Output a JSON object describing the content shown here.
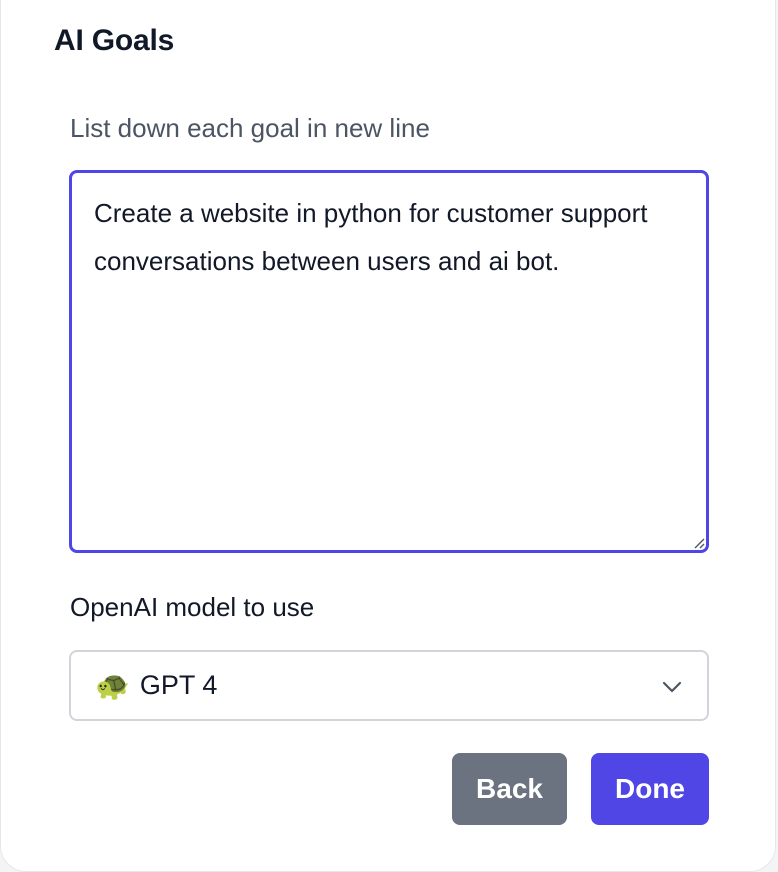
{
  "modal": {
    "title": "AI Goals",
    "goals_label": "List down each goal in new line",
    "goals_value": "Create a website in python for customer support conversations between users and ai bot.",
    "model_label": "OpenAI model to use",
    "model_emoji": "🐢",
    "model_selected": "GPT 4",
    "back_label": "Back",
    "done_label": "Done"
  },
  "icons": {
    "model": "turtle-icon",
    "dropdown": "chevron-down-icon",
    "resize": "resize-handle-icon"
  },
  "colors": {
    "accent": "#4f46e5",
    "secondary_button": "#6b7280",
    "title_text": "#111827",
    "label_text": "#4b5563",
    "border": "#d1d5db"
  }
}
